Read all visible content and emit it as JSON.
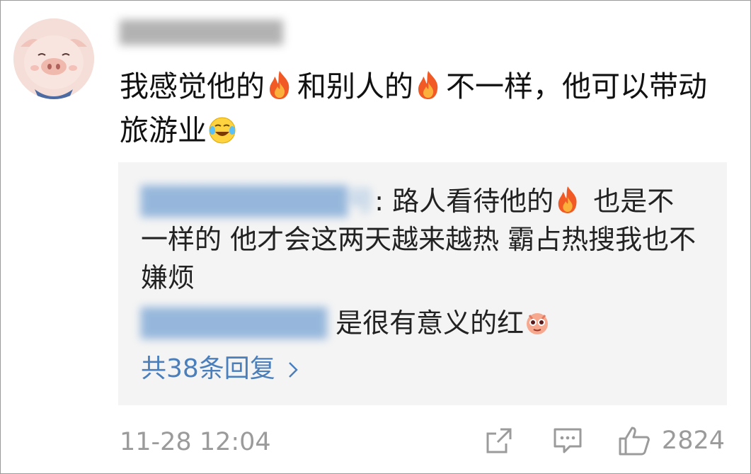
{
  "comment": {
    "username": "██████████",
    "text_parts": [
      "我感觉他的",
      "和别人的",
      "不一样，他可以带动旅游业"
    ],
    "emojis": [
      "fire-emoji",
      "fire-emoji",
      "laugh-cry-emoji"
    ]
  },
  "reply_box": {
    "reply1_name": "██████████号",
    "reply1_text_a": ": 路人看待他的",
    "reply1_text_b": " 也是不一样的 他才会这两天越来越热 霸占热搜我也不嫌烦",
    "reply2_name": "█████████",
    "reply2_text": " 是很有意义的红",
    "more_replies": "共38条回复"
  },
  "footer": {
    "timestamp": "11-28 12:04",
    "like_count": "2824"
  },
  "colors": {
    "link": "#4a7fbc",
    "muted": "#9b9b9b",
    "reply_bg": "#f4f4f4"
  }
}
